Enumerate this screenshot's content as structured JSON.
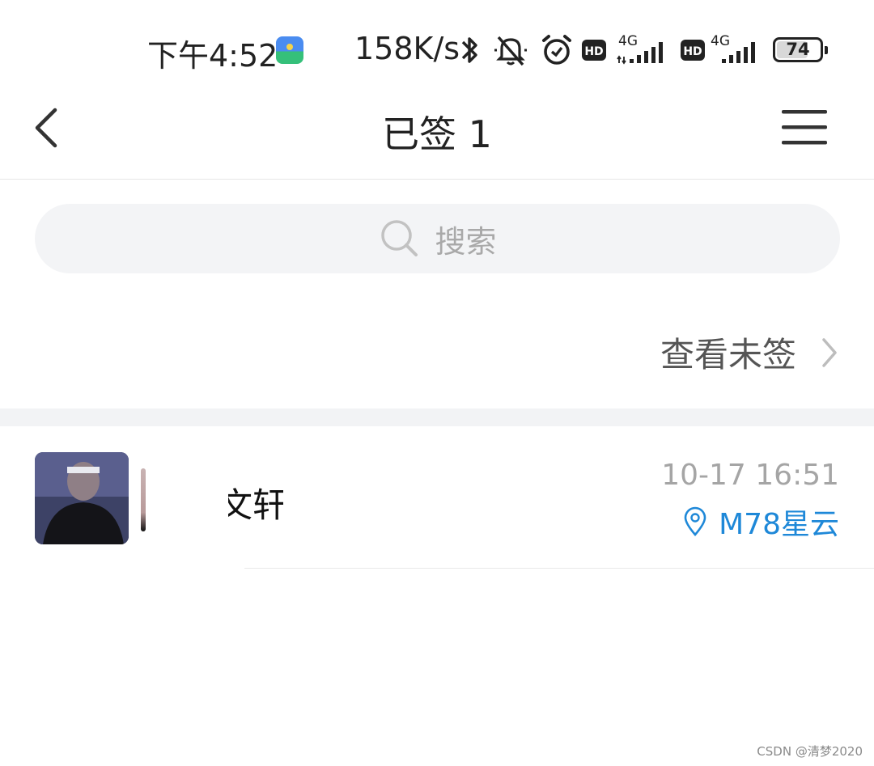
{
  "status_bar": {
    "time": "下午4:52",
    "net_speed": "158K/s",
    "network_type_1": "4G",
    "network_type_2": "4G",
    "hd_label": "HD",
    "battery": "74",
    "battery_level": 0.74
  },
  "nav": {
    "title": "已签 1"
  },
  "search": {
    "placeholder": "搜索"
  },
  "view_unsigned": {
    "label": "查看未签"
  },
  "list": {
    "items": [
      {
        "name": "文轩",
        "time": "10-17 16:51",
        "location": "M78星云"
      }
    ]
  },
  "watermark": "CSDN @清梦2020",
  "colors": {
    "accent": "#1e88d8",
    "search_bg": "#f3f4f6",
    "section_gap": "#f2f3f5"
  }
}
